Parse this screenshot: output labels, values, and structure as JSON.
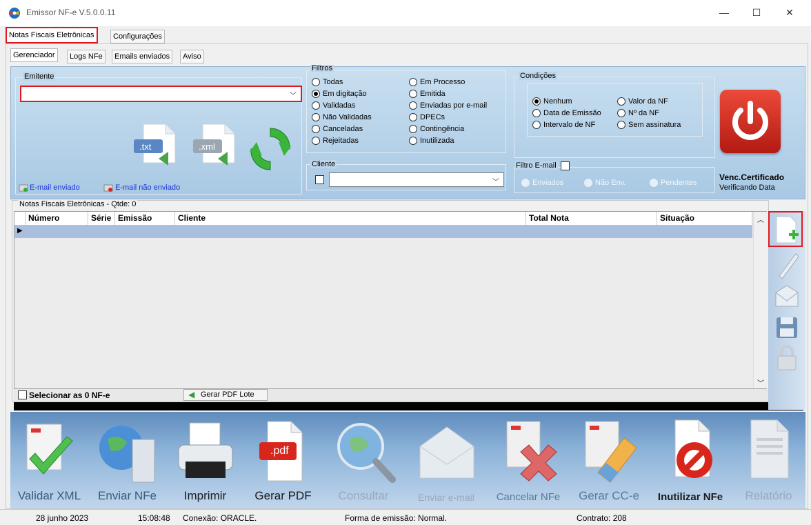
{
  "window": {
    "title": "Emissor NF-e V.5.0.0.11",
    "min": "—",
    "max": "☐",
    "close": "✕"
  },
  "main_tabs": [
    "Notas Fiscais Eletrônicas",
    "Configurações"
  ],
  "sub_tabs": [
    "Gerenciador",
    "Logs NFe",
    "Emails enviados",
    "Aviso"
  ],
  "emitente": {
    "label": "Emitente",
    "value": ""
  },
  "email_legend": {
    "sent": "E-mail enviado",
    "not_sent": "E-mail não enviado"
  },
  "file_icons": {
    "txt": ".txt",
    "xml": ".xml"
  },
  "filtros": {
    "label": "Filtros",
    "col1": [
      "Todas",
      "Em digitação",
      "Validadas",
      "Não Validadas",
      "Canceladas",
      "Rejeitadas"
    ],
    "col2": [
      "Em Processo",
      "Emitida",
      "Enviadas por e-mail",
      "DPECs",
      "Contingência",
      "Inutilizada"
    ],
    "selected": "Em digitação"
  },
  "cliente": {
    "label": "Cliente",
    "value": ""
  },
  "condicoes": {
    "label": "Condições",
    "col1": [
      "Nenhum",
      "Data de Emissão",
      "Intervalo de NF"
    ],
    "col2": [
      "Valor da NF",
      "Nº da NF",
      "Sem assinatura"
    ],
    "selected": "Nenhum"
  },
  "filtro_email": {
    "label": "Filtro E-mail",
    "options": [
      "Enviados",
      "Não Env.",
      "Pendentes"
    ]
  },
  "certificado": {
    "title": "Venc.Certificado",
    "status": "Verificando Data"
  },
  "grid": {
    "group_label": "Notas Fiscais Eletrônicas - Qtde: 0",
    "columns": [
      "Número",
      "Série",
      "Emissão",
      "Cliente",
      "Total Nota",
      "Situação"
    ],
    "select_all": "Selecionar as 0 NF-e",
    "pdf_lote": "Gerar PDF Lote"
  },
  "actions": [
    {
      "label": "Validar XML",
      "enabled": false
    },
    {
      "label": "Enviar NFe",
      "enabled": false
    },
    {
      "label": "Imprimir",
      "enabled": true
    },
    {
      "label": "Gerar PDF",
      "enabled": true
    },
    {
      "label": "Consultar",
      "enabled": false
    },
    {
      "label": "Enviar e-mail",
      "enabled": false
    },
    {
      "label": "Cancelar NFe",
      "enabled": false
    },
    {
      "label": "Gerar CC-e",
      "enabled": false
    },
    {
      "label": "Inutilizar NFe",
      "enabled": true
    },
    {
      "label": "Relatório",
      "enabled": false
    }
  ],
  "pdf_icon_text": ".pdf",
  "status": {
    "date": "28 junho 2023",
    "time": "15:08:48",
    "conexao": "Conexão: ORACLE.",
    "forma": "Forma de emissão: Normal.",
    "contrato": "Contrato: 208"
  },
  "colors": {
    "panel": "#b7d0e8",
    "power": "#d9261c",
    "highlight": "#e0191e",
    "row": "#a9bfdd"
  }
}
